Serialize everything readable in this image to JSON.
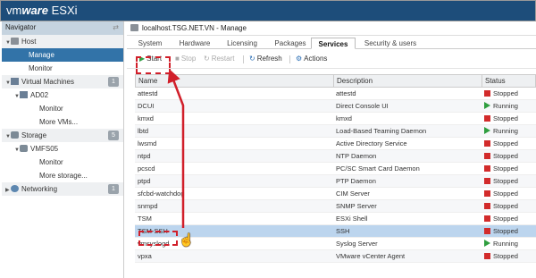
{
  "app": {
    "brand_light": "vm",
    "brand_bold": "ware",
    "brand_product": " ESXi"
  },
  "navigator": {
    "title": "Navigator",
    "pin": "⇄",
    "items": [
      {
        "label": "Host",
        "kind": "group",
        "icon": "host-icon"
      },
      {
        "label": "Manage",
        "kind": "selected"
      },
      {
        "label": "Monitor",
        "kind": "child"
      },
      {
        "label": "Virtual Machines",
        "kind": "group",
        "icon": "vm-icon",
        "count": "1"
      },
      {
        "label": "AD02",
        "kind": "sub",
        "icon": "vm-icon"
      },
      {
        "label": "Monitor",
        "kind": "child2"
      },
      {
        "label": "More VMs...",
        "kind": "child2"
      },
      {
        "label": "Storage",
        "kind": "group",
        "icon": "storage-icon",
        "count": "5"
      },
      {
        "label": "VMFS05",
        "kind": "sub",
        "icon": "storage-icon"
      },
      {
        "label": "Monitor",
        "kind": "child2"
      },
      {
        "label": "More storage...",
        "kind": "child2"
      },
      {
        "label": "Networking",
        "kind": "group",
        "icon": "network-icon",
        "count": "1"
      }
    ]
  },
  "main": {
    "title": "localhost.TSG.NET.VN - Manage",
    "tabs": [
      "System",
      "Hardware",
      "Licensing",
      "Packages",
      "Services",
      "Security & users"
    ],
    "active_tab": "Services"
  },
  "toolbar": {
    "start": "Start",
    "stop": "Stop",
    "restart": "Restart",
    "refresh": "Refresh",
    "actions": "Actions"
  },
  "grid": {
    "columns": [
      "Name",
      "Description",
      "Status"
    ],
    "rows": [
      {
        "name": "attestd",
        "description": "attestd",
        "status": "Stopped"
      },
      {
        "name": "DCUI",
        "description": "Direct Console UI",
        "status": "Running"
      },
      {
        "name": "kmxd",
        "description": "kmxd",
        "status": "Stopped"
      },
      {
        "name": "lbtd",
        "description": "Load-Based Teaming Daemon",
        "status": "Running"
      },
      {
        "name": "lwsmd",
        "description": "Active Directory Service",
        "status": "Stopped"
      },
      {
        "name": "ntpd",
        "description": "NTP Daemon",
        "status": "Stopped"
      },
      {
        "name": "pcscd",
        "description": "PC/SC Smart Card Daemon",
        "status": "Stopped"
      },
      {
        "name": "ptpd",
        "description": "PTP Daemon",
        "status": "Stopped"
      },
      {
        "name": "sfcbd-watchdog",
        "description": "CIM Server",
        "status": "Stopped"
      },
      {
        "name": "snmpd",
        "description": "SNMP Server",
        "status": "Stopped"
      },
      {
        "name": "TSM",
        "description": "ESXi Shell",
        "status": "Stopped"
      },
      {
        "name": "TSM-SSH",
        "description": "SSH",
        "status": "Stopped",
        "selected": true
      },
      {
        "name": "vmsyslogd",
        "description": "Syslog Server",
        "status": "Running"
      },
      {
        "name": "vpxa",
        "description": "VMware vCenter Agent",
        "status": "Stopped"
      }
    ]
  },
  "colors": {
    "brand_bar": "#1d4d7a",
    "selected_nav": "#3273a8",
    "highlight": "#d11f2a",
    "stopped": "#d22b2b",
    "running": "#2f9e3f"
  }
}
